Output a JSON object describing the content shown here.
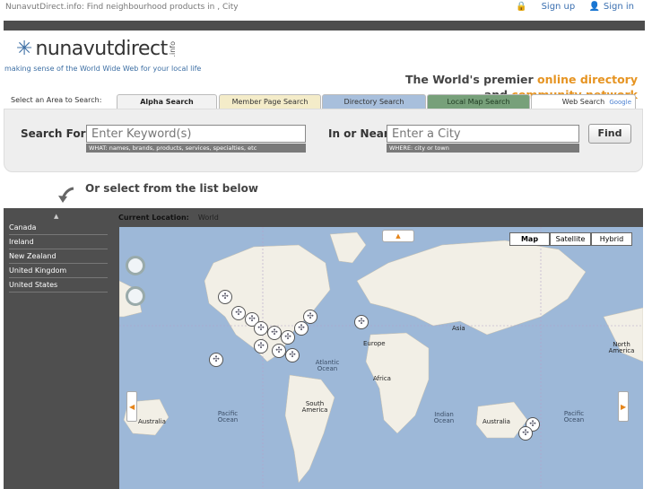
{
  "top": {
    "page_title": "NunavutDirect.info: Find neighbourhood products in , City",
    "signup": "Sign up",
    "signin": "Sign in"
  },
  "header": {
    "logo_name": "nunavutdirect",
    "logo_suffix": ".info",
    "tagline": "making sense of the World Wide Web for your local life",
    "premier_line1_a": "The World's premier",
    "premier_line1_b": "online directory",
    "premier_line2_a": "and",
    "premier_line2_b": "community network"
  },
  "search_area": {
    "select_label": "Select an Area to Search:",
    "tabs": [
      "Alpha Search",
      "Member Page Search",
      "Directory Search",
      "Local Map Search",
      "Web Search"
    ],
    "google_label": "Google",
    "search_for_label": "Search For:",
    "keyword_value": "Enter Keyword(s)",
    "keyword_hint": "WHAT: names, brands, products, services, specialties, etc",
    "in_or_near_label": "In or Near:",
    "city_value": "Enter a City",
    "city_hint": "WHERE: city or town",
    "find_label": "Find"
  },
  "list": {
    "heading": "Or select from the list below",
    "countries": [
      "Canada",
      "Ireland",
      "New Zealand",
      "United Kingdom",
      "United States"
    ]
  },
  "map": {
    "current_location_label": "Current Location:",
    "current_location_value": "World",
    "types": [
      "Map",
      "Satellite",
      "Hybrid"
    ],
    "selected_type": "Map",
    "labels": {
      "europe": "Europe",
      "asia": "Asia",
      "north_america": "North America",
      "africa": "Africa",
      "south_america": "South America",
      "australia_left": "Australia",
      "australia_right": "Australia",
      "atlantic": "Atlantic Ocean",
      "pacific_left": "Pacific Ocean",
      "pacific_right": "Pacific Ocean",
      "indian": "Indian Ocean"
    }
  }
}
